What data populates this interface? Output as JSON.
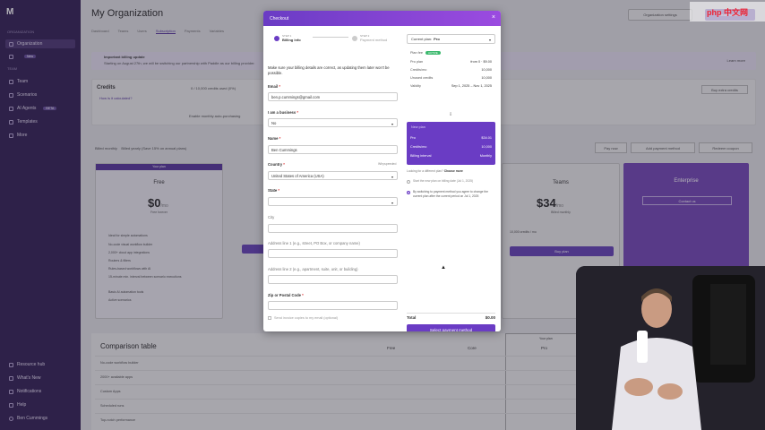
{
  "sidebar": {
    "logo": "M",
    "section_org": "ORGANIZATION",
    "section_team": "TEAM",
    "items_org": [
      {
        "label": "Organization",
        "icon": "building-icon",
        "active": true
      },
      {
        "label": "",
        "badge": "New",
        "icon": "bolt-icon",
        "active": false
      }
    ],
    "items_team": [
      {
        "label": "Team",
        "icon": "users-icon"
      },
      {
        "label": "Scenarios",
        "icon": "share-icon"
      },
      {
        "label": "AI Agents",
        "badge": "BETA",
        "icon": "robot-icon"
      },
      {
        "label": "Templates",
        "icon": "template-icon"
      },
      {
        "label": "More",
        "icon": "dots-icon"
      }
    ],
    "bottom_items": [
      {
        "label": "Resource hub",
        "icon": "book-icon"
      },
      {
        "label": "What's New",
        "icon": "gift-icon"
      },
      {
        "label": "Notifications",
        "icon": "bell-icon"
      },
      {
        "label": "Help",
        "icon": "help-icon"
      },
      {
        "label": "Ben Cummings",
        "icon": "avatar-icon"
      }
    ]
  },
  "page": {
    "title": "My Organization",
    "tabs": [
      "Dashboard",
      "Teams",
      "Users",
      "Subscription",
      "Payments",
      "Variables"
    ],
    "active_tab": 3,
    "btn_org_settings": "Organization settings",
    "btn_create": "Create scenario",
    "banner_title": "Important billing update",
    "banner_text": "Starting on August 27th, we will be switching our partnership with Paddle as our billing provider.",
    "banner_link": "Learn more",
    "credits_title": "Credits",
    "credits_link": "How is it calculated?",
    "credits_used": "0 / 10,000 credits used (0%)",
    "credits_buy": "Buy extra credits",
    "credits_auto": "Enable monthly auto-purchasing",
    "billing_label": "Billed monthly",
    "billing_toggle": "Billed yearly (Save 15% on annual plans)",
    "ctrl_btns": [
      "Pay now",
      "Add payment method",
      "Redeem coupon"
    ],
    "plan_free": {
      "tag": "Your plan",
      "name": "Free",
      "price": "$0",
      "per": "/mo",
      "sub": "Free forever",
      "features": [
        "Ideal for simple automations",
        "No-code visual workflow builder",
        "2,000+ cloud app integrations",
        "Routers & filters",
        "Rules-based workflows with AI",
        "15-minute min. interval between scenario executions",
        "Basic AI automation tools",
        "Active scenarios"
      ]
    },
    "plan_teams": {
      "name": "Teams",
      "price": "$34",
      "per": "/mo",
      "sub": "Billed monthly",
      "buy": "Buy plan",
      "credits": "10,000 credits / mo"
    },
    "plan_ent": {
      "name": "Enterprise",
      "btn": "Contact us"
    },
    "cmp_title": "Comparison table",
    "cmp_heads": [
      "Free",
      "Core",
      "Pro"
    ],
    "cmp_pro_tag": "Your plan",
    "cmp_rows": [
      "No-code workflow builder",
      "2000+ available apps",
      "Custom Apps",
      "Scheduled runs",
      "Top-notch performance"
    ]
  },
  "modal": {
    "title": "Checkout",
    "step1_small": "STEP 1",
    "step1": "Billing info",
    "step2_small": "STEP 2",
    "step2": "Payment method",
    "intro": "Make sure your billing details are correct, as updating them later won't be possible.",
    "email_label": "Email",
    "email_value": "ben.p.cummings@gmail.com",
    "business_label": "I am a business",
    "business_value": "No",
    "name_label": "Name",
    "name_value": "Ben Cummings",
    "country_label": "Country",
    "country_hint": "Whyspeeded",
    "country_value": "United States of America (USA)",
    "state_label": "State",
    "city_label": "City",
    "addr1_label": "Address line 1 (e.g., street, PO Box, or company name)",
    "addr2_label": "Address line 2 (e.g., apartment, suite, unit, or building)",
    "zip_label": "Zip or Postal Code",
    "privacy": "Send invoice copies to my email (optional)",
    "current_plan_prefix": "Current plan:",
    "current_plan": "Pro",
    "cur_rows": [
      {
        "k": "Plan fee",
        "v": "",
        "badge": "ACTIVE"
      },
      {
        "k": "Pro plan",
        "v": "from 0 · $9.00"
      },
      {
        "k": "Credits/mo",
        "v": "10,000"
      },
      {
        "k": "Unused credits",
        "v": "10,000"
      },
      {
        "k": "Validity",
        "v": "Sep 1, 2025 – Nov 1, 2025"
      }
    ],
    "new_plan_head": "New plan",
    "new_rows": [
      {
        "k": "Pro",
        "v": "$34.01"
      },
      {
        "k": "Credits/mo",
        "v": "10,000"
      },
      {
        "k": "Billing interval",
        "v": "Monthly"
      }
    ],
    "cancel_note": "Looking for a different plan?",
    "cancel_link": "Choose more",
    "radio1": "Start the new plan on billing date (Jul 1, 2025)",
    "radio2": "By switching to payment method you agree to change the current plan after the current period on Jul 1, 2025",
    "total_label": "Total",
    "total_value": "$0.00",
    "pay_button": "Select payment method"
  },
  "watermark": "php 中文网"
}
